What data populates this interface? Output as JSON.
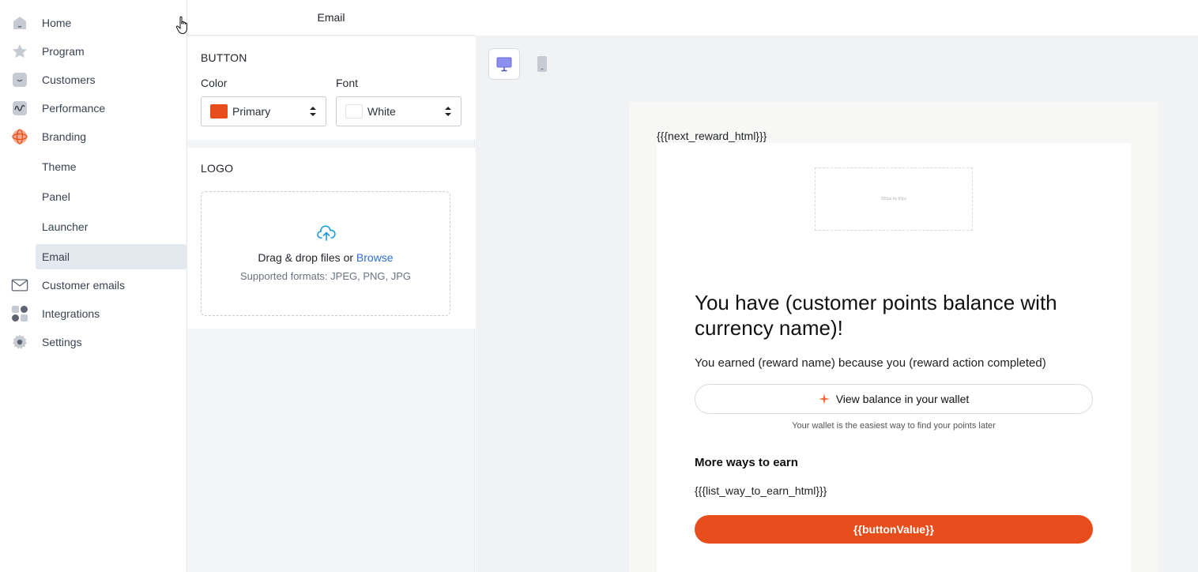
{
  "sidebar": {
    "items": [
      {
        "label": "Home",
        "icon": "home-icon"
      },
      {
        "label": "Program",
        "icon": "star-icon"
      },
      {
        "label": "Customers",
        "icon": "smiley-icon"
      },
      {
        "label": "Performance",
        "icon": "wave-chart-icon"
      },
      {
        "label": "Branding",
        "icon": "branding-icon"
      }
    ],
    "branding_sub": [
      {
        "label": "Theme"
      },
      {
        "label": "Panel"
      },
      {
        "label": "Launcher"
      },
      {
        "label": "Email",
        "active": true
      }
    ],
    "lower_items": [
      {
        "label": "Customer emails",
        "icon": "envelope-icon"
      },
      {
        "label": "Integrations",
        "icon": "grid-apps-icon"
      },
      {
        "label": "Settings",
        "icon": "gear-icon"
      }
    ]
  },
  "panel": {
    "header_title": "Email",
    "button_section": {
      "title": "BUTTON",
      "color_label": "Color",
      "color_value": "Primary",
      "color_swatch": "#e84e1b",
      "font_label": "Font",
      "font_value": "White",
      "font_swatch": "#ffffff"
    },
    "logo_section": {
      "title": "LOGO",
      "drop_text": "Drag & drop files or ",
      "browse_label": "Browse",
      "formats": "Supported formats: JPEG, PNG, JPG"
    }
  },
  "preview": {
    "devices": [
      {
        "name": "desktop-icon",
        "active": true
      },
      {
        "name": "mobile-icon",
        "active": false
      }
    ],
    "next_reward": "{{{next_reward_html}}}",
    "logo_placeholder": "300px by 80px",
    "heading": "You have (customer points balance with currency name)!",
    "earned_text": "You earned (reward name) because you (reward action completed)",
    "wallet_button": "View balance in your wallet",
    "wallet_note": "Your wallet is the easiest way to find your points later",
    "ways_heading": "More ways to earn",
    "ways_list": "{{{list_way_to_earn_html}}}",
    "cta_button": "{{buttonValue}}"
  },
  "colors": {
    "accent": "#e84e1b",
    "active_nav_bg": "#e4e8ef",
    "device_active": "#6b6bd6",
    "link": "#2f6fd6"
  }
}
